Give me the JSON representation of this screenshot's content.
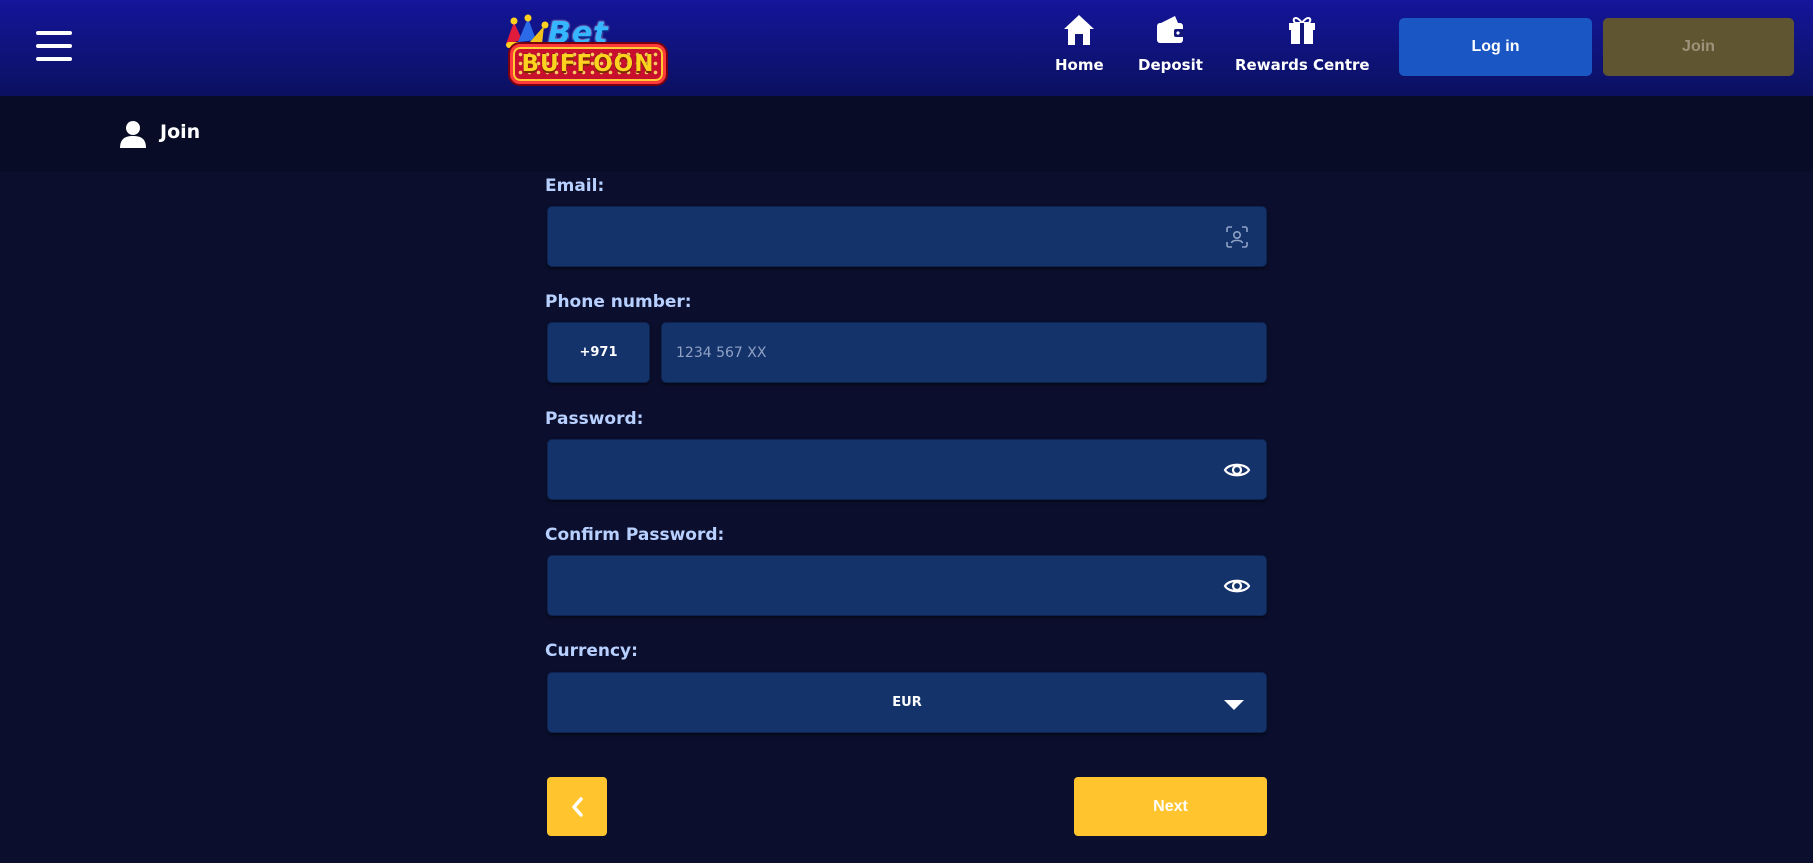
{
  "header": {
    "logo": {
      "line1": "Bet",
      "line2": "BUFFOON"
    },
    "nav": [
      {
        "label": "Home",
        "icon": "home-icon"
      },
      {
        "label": "Deposit",
        "icon": "wallet-icon"
      },
      {
        "label": "Rewards Centre",
        "icon": "gift-icon"
      }
    ],
    "login_label": "Log in",
    "join_label": "Join"
  },
  "subheader": {
    "title": "Join",
    "icon": "user-icon"
  },
  "form": {
    "email": {
      "label": "Email:",
      "value": "",
      "placeholder": "",
      "icon": "contact-scan-icon"
    },
    "phone": {
      "label": "Phone number:",
      "prefix": "+971",
      "value": "",
      "placeholder": "1234 567 XX"
    },
    "password": {
      "label": "Password:",
      "value": "",
      "icon": "eye-icon"
    },
    "confirm_password": {
      "label": "Confirm Password:",
      "value": "",
      "icon": "eye-icon"
    },
    "currency": {
      "label": "Currency:",
      "selected": "EUR",
      "icon": "caret-down-icon"
    },
    "back_icon": "chevron-left-icon",
    "next_label": "Next"
  },
  "colors": {
    "header_bg": "#14159a",
    "page_bg": "#0b0f2d",
    "field_bg": "#15336b",
    "login_btn": "#1a56c4",
    "join_btn_disabled": "#5f5531",
    "accent_yellow": "#ffc42e",
    "label_color": "#b8d0ff"
  }
}
